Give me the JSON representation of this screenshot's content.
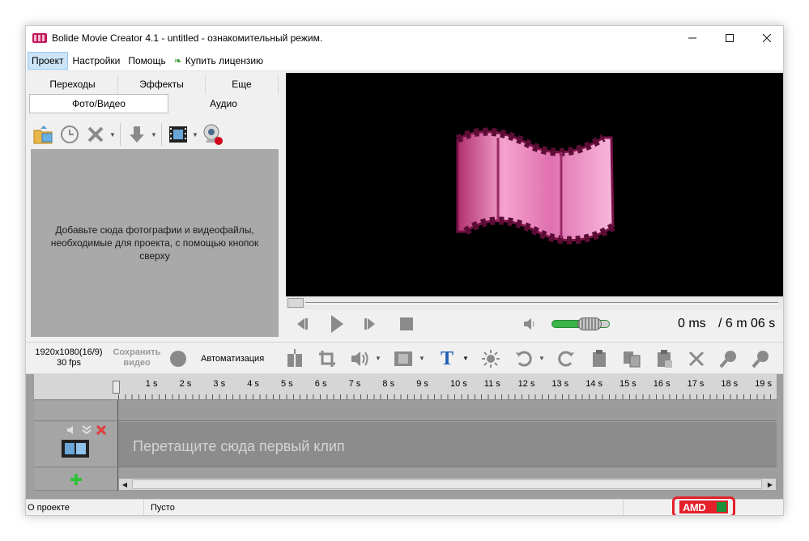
{
  "window": {
    "title": "Bolide Movie Creator 4.1 - untitled  - ознакомительный режим.",
    "minimize_icon": "minimize-icon",
    "maximize_icon": "maximize-icon",
    "close_icon": "close-icon"
  },
  "menu": {
    "items": [
      {
        "label": "Проект"
      },
      {
        "label": "Настройки"
      },
      {
        "label": "Помощь"
      },
      {
        "label": "Купить лицензию",
        "icon": "leaf-icon"
      }
    ]
  },
  "left_tabs": {
    "row1": [
      {
        "label": "Переходы"
      },
      {
        "label": "Эффекты"
      },
      {
        "label": "Еще"
      }
    ],
    "row2": [
      {
        "label": "Фото/Видео"
      },
      {
        "label": "Аудио"
      }
    ]
  },
  "media": {
    "placeholder": "Добавьте сюда фотографии и видеофайлы, необходимые для проекта, с помощью кнопок сверху"
  },
  "player": {
    "current_time": "0 ms",
    "total_time": "/ 6 m 06 s",
    "volume_fraction": 0.85
  },
  "midbar": {
    "resolution": "1920x1080(16/9)",
    "fps": "30 fps",
    "save_video_line1": "Сохранить",
    "save_video_line2": "видео",
    "automation": "Автоматизация"
  },
  "timeline": {
    "ruler_labels": [
      "1 s",
      "2 s",
      "3 s",
      "4 s",
      "5 s",
      "6 s",
      "7 s",
      "8 s",
      "9 s",
      "10 s",
      "11 s",
      "12 s",
      "13 s",
      "14 s",
      "15 s",
      "16 s",
      "17 s",
      "18 s",
      "19 s"
    ],
    "drop_hint": "Перетащите сюда первый клип"
  },
  "status": {
    "about": "О проекте",
    "state": "Пусто",
    "brand": "AMD"
  },
  "colors": {
    "accent_green": "#39b54a",
    "amd_red": "#e4202a",
    "preview_bg": "#000000"
  }
}
